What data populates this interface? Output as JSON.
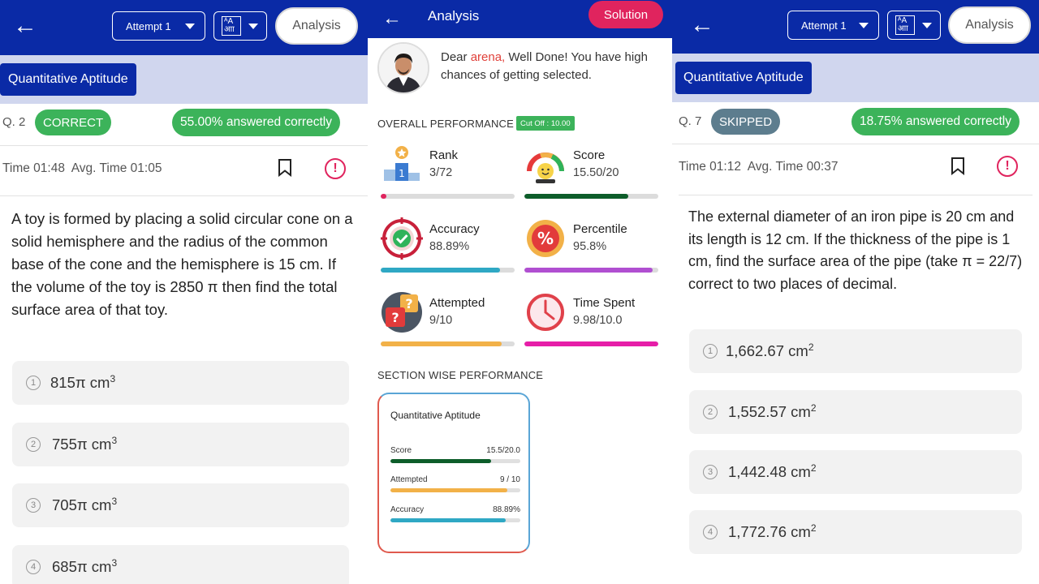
{
  "left": {
    "header": {
      "attempt": "Attempt 1",
      "lang_glyph": "アA\nआी",
      "analysis": "Analysis"
    },
    "section": "Quantitative Aptitude",
    "qnum": "Q. 2",
    "status": "CORRECT",
    "answered_correctly": "55.00% answered correctly",
    "time": "Time 01:48",
    "avg_time": "Avg. Time 01:05",
    "question": "A toy is formed by placing a solid circular cone on a solid hemisphere and the radius of the common base of the cone and the hemisphere is 15 cm. If the volume of the toy is 2850 π then find the total surface area of that toy.",
    "options": [
      {
        "num": "1",
        "text": "815π cm",
        "sup": "3"
      },
      {
        "num": "2",
        "text": "755π cm",
        "sup": "3"
      },
      {
        "num": "3",
        "text": "705π cm",
        "sup": "3"
      },
      {
        "num": "4",
        "text": "685π cm",
        "sup": "3"
      }
    ]
  },
  "middle": {
    "title": "Analysis",
    "solution": "Solution",
    "greeting_prefix": "Dear ",
    "user_name": "arena,",
    "greeting_rest": " Well Done! You have high chances of getting selected.",
    "overall_heading": "OVERALL PERFORMANCE",
    "cutoff": "Cut Off : 10.00",
    "stats": [
      {
        "label": "Rank",
        "value": "3/72",
        "fraction": 0.042,
        "color": "#e0245e",
        "icon": "rank-podium-icon"
      },
      {
        "label": "Score",
        "value": "15.50/20",
        "fraction": 0.775,
        "color": "#0d5d2a",
        "icon": "score-gauge-icon"
      },
      {
        "label": "Accuracy",
        "value": "88.89%",
        "fraction": 0.889,
        "color": "#2fa8c4",
        "icon": "accuracy-target-icon"
      },
      {
        "label": "Percentile",
        "value": "95.8%",
        "fraction": 0.958,
        "color": "#b04fd1",
        "icon": "percentile-badge-icon"
      },
      {
        "label": "Attempted",
        "value": "9/10",
        "fraction": 0.9,
        "color": "#f2b148",
        "icon": "attempted-question-icon"
      },
      {
        "label": "Time Spent",
        "value": "9.98/10.0",
        "fraction": 0.998,
        "color": "#e61ea8",
        "icon": "clock-icon"
      }
    ],
    "section_heading": "SECTION WISE PERFORMANCE",
    "section_card": {
      "title": "Quantitative Aptitude",
      "rows": [
        {
          "label": "Score",
          "value": "15.5/20.0",
          "fraction": 0.775,
          "color": "#0d5d2a"
        },
        {
          "label": "Attempted",
          "value": "9 / 10",
          "fraction": 0.9,
          "color": "#f2b148"
        },
        {
          "label": "Accuracy",
          "value": "88.89%",
          "fraction": 0.889,
          "color": "#2fa8c4"
        }
      ]
    }
  },
  "right": {
    "header": {
      "attempt": "Attempt 1",
      "lang_glyph": "アA\nआी",
      "analysis": "Analysis"
    },
    "section": "Quantitative Aptitude",
    "qnum": "Q. 7",
    "status": "SKIPPED",
    "answered_correctly": "18.75% answered correctly",
    "time": "Time 01:12",
    "avg_time": "Avg. Time 00:37",
    "question": "The external diameter of an iron pipe is 20 cm and its length is 12 cm. If the thickness of the pipe is 1 cm, find the surface area of the pipe (take π = 22/7) correct to two places of decimal.",
    "options": [
      {
        "num": "1",
        "text": "1,662.67 cm",
        "sup": "2"
      },
      {
        "num": "2",
        "text": "1,552.57 cm",
        "sup": "2"
      },
      {
        "num": "3",
        "text": "1,442.48 cm",
        "sup": "2"
      },
      {
        "num": "4",
        "text": "1,772.76 cm",
        "sup": "2"
      }
    ]
  },
  "colors": {
    "header_blue": "#0a2aa6",
    "correct_green": "#3cb35a",
    "skipped_gray": "#5d7d8e",
    "accent_pink": "#e0245e"
  }
}
